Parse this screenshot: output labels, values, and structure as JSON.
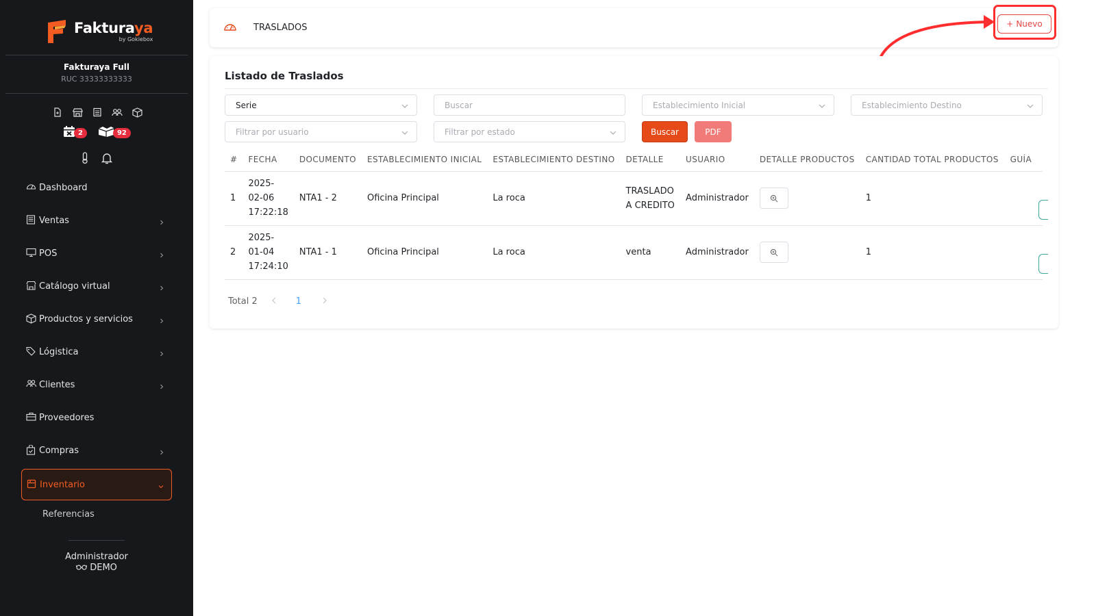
{
  "brand": {
    "name_main": "Faktura",
    "name_accent": "ya",
    "tagline": "by Gokiebox"
  },
  "company": {
    "name": "Fakturaya Full",
    "ruc": "RUC 33333333333"
  },
  "badges": {
    "calendar": "2",
    "boxes": "92"
  },
  "sidebar": {
    "items": [
      {
        "label": "Dashboard"
      },
      {
        "label": "Ventas"
      },
      {
        "label": "POS"
      },
      {
        "label": "Catálogo virtual"
      },
      {
        "label": "Productos y servicios"
      },
      {
        "label": "Lógistica"
      },
      {
        "label": "Clientes"
      },
      {
        "label": "Proveedores"
      },
      {
        "label": "Compras"
      },
      {
        "label": "Inventario"
      }
    ],
    "sub_items": [
      {
        "label": "Referencias"
      }
    ]
  },
  "user": {
    "name": "Administrador",
    "mode": "DEMO"
  },
  "header": {
    "title": "TRASLADOS",
    "new_button": "Nuevo"
  },
  "list": {
    "title": "Listado de Traslados",
    "filters": {
      "serie": "Serie",
      "buscar_placeholder": "Buscar",
      "est_inicial_placeholder": "Establecimiento Inicial",
      "est_destino_placeholder": "Establecimiento Destino",
      "usuario_placeholder": "Filtrar por usuario",
      "estado_placeholder": "Filtrar por estado"
    },
    "buttons": {
      "buscar": "Buscar",
      "pdf": "PDF"
    },
    "columns": [
      "#",
      "FECHA",
      "DOCUMENTO",
      "ESTABLECIMIENTO INICIAL",
      "ESTABLECIMIENTO DESTINO",
      "DETALLE",
      "USUARIO",
      "DETALLE PRODUCTOS",
      "CANTIDAD TOTAL PRODUCTOS",
      "GUÍA"
    ],
    "rows": [
      {
        "num": "1",
        "date": "2025-",
        "date2": "02-06",
        "time": "17:22:18",
        "documento": "NTA1 - 2",
        "inicial": "Oficina Principal",
        "destino": "La roca",
        "detalle": "TRASLADO",
        "detalle2": "A CREDITO",
        "usuario": "Administrador",
        "cantidad": "1"
      },
      {
        "num": "2",
        "date": "2025-",
        "date2": "01-04",
        "time": "17:24:10",
        "documento": "NTA1 - 1",
        "inicial": "Oficina Principal",
        "destino": "La roca",
        "detalle": "venta",
        "detalle2": "",
        "usuario": "Administrador",
        "cantidad": "1"
      }
    ],
    "pagination": {
      "total": "Total 2",
      "current": "1"
    }
  },
  "colors": {
    "accent": "#f25c23",
    "sidebar_bg": "#16181c",
    "highlight": "#ff2d2d",
    "teal": "#3aa89b"
  }
}
